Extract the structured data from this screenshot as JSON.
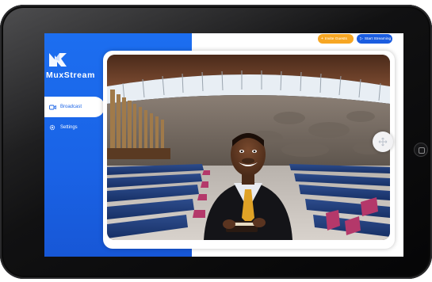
{
  "app": {
    "brand_name": "MuxStream"
  },
  "header": {
    "invite_label": "Invite Guests",
    "stream_label": "Start Streaming"
  },
  "sidebar": {
    "items": [
      {
        "label": "Broadcast",
        "icon": "camera-icon",
        "active": true
      },
      {
        "label": "Settings",
        "icon": "gear-icon",
        "active": false
      }
    ]
  },
  "colors": {
    "accent_blue": "#1a63e6",
    "invite_orange": "#f6a623",
    "stream_blue": "#1a5ce0"
  }
}
